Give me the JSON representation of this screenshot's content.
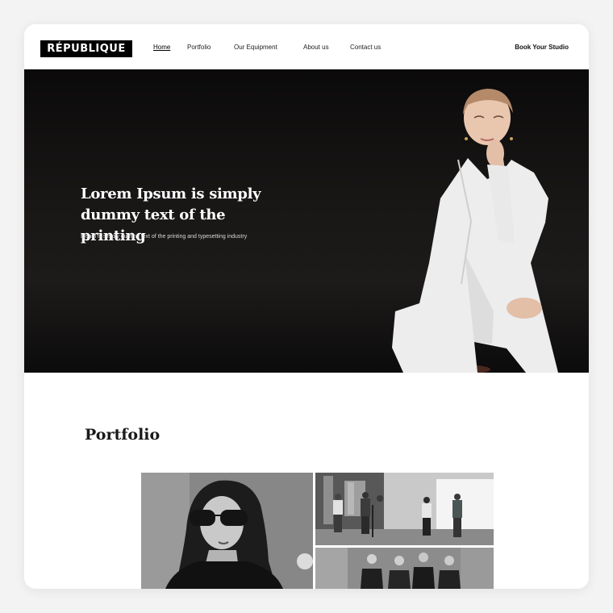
{
  "nav": {
    "logo": "RÉPUBLIQUE",
    "links": [
      {
        "label": "Home",
        "active": true
      },
      {
        "label": "Portfolio"
      },
      {
        "label": "Our Equipment"
      },
      {
        "label": "About us"
      },
      {
        "label": "Contact us"
      }
    ],
    "cta": "Book Your Studio"
  },
  "hero": {
    "title": "Lorem Ipsum is simply dummy text of the printing",
    "subtitle": "Ipsum is simply dummy text of the printing and typesetting industry"
  },
  "portfolio": {
    "title": "Portfolio"
  },
  "colors": {
    "hero_bg": "#1a1817",
    "text_dark": "#1a1a1a",
    "page_bg": "#f3f3f3"
  }
}
